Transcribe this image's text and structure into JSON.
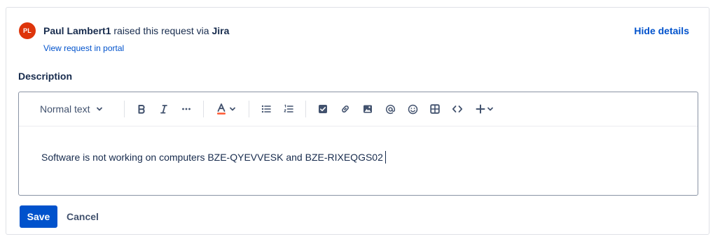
{
  "request": {
    "avatar_initials": "PL",
    "avatar_color": "#de350b",
    "reporter_name": "Paul Lambert1",
    "raised_text": " raised this request via ",
    "channel": "Jira",
    "portal_link": "View request in portal",
    "hide_details": "Hide details"
  },
  "description": {
    "label": "Description",
    "toolbar": {
      "text_style": "Normal text",
      "tools": [
        "bold-icon",
        "italic-icon",
        "more-formatting-icon",
        "text-color-icon",
        "bullet-list-icon",
        "numbered-list-icon",
        "action-item-icon",
        "link-icon",
        "image-icon",
        "mention-icon",
        "emoji-icon",
        "table-icon",
        "code-icon",
        "insert-icon"
      ]
    },
    "content": "Software is not working on computers BZE-QYEVVESK and BZE-RIXEQGS02"
  },
  "actions": {
    "save": "Save",
    "cancel": "Cancel"
  },
  "colors": {
    "accent": "#0052cc",
    "text": "#172b4d",
    "text_color_swatch": "#ff5630"
  }
}
